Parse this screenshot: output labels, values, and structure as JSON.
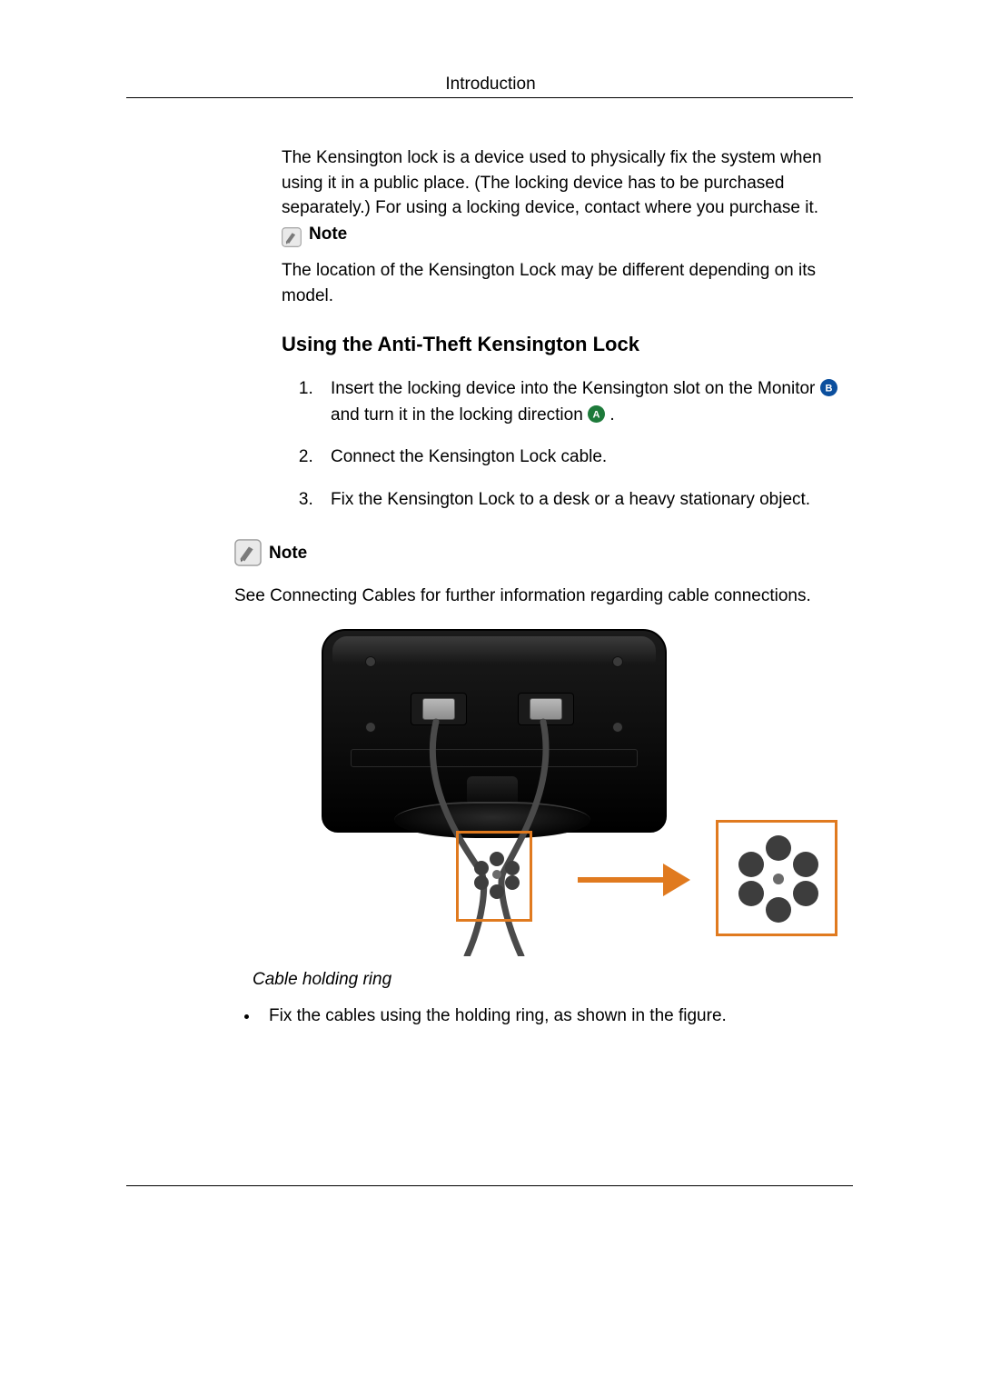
{
  "header": {
    "title": "Introduction"
  },
  "intro": {
    "para": "The Kensington lock is a device used to physically fix the system when using it in a public place. (The locking device has to be purchased separately.) For using a locking device, contact where you purchase it.",
    "note_label": "Note",
    "note_text": "The location of the Kensington Lock may be different depending on its model."
  },
  "section": {
    "heading": "Using the Anti-Theft Kensington Lock",
    "step1_a": "Insert the locking device into the Kensington slot on the Monitor ",
    "step1_b": "and turn it in the locking direction ",
    "step1_c": ".",
    "badge_b": "B",
    "badge_a": "A",
    "step2": "Connect the Kensington Lock cable.",
    "step3": "Fix the Kensington Lock to a desk or a heavy stationary object."
  },
  "note2": {
    "label": "Note",
    "text": "See Connecting Cables for further information regarding cable connections."
  },
  "figure": {
    "caption": "Cable holding ring",
    "bullet": "Fix the cables using the holding ring, as shown in the figure."
  },
  "icons": {
    "note": "note-icon"
  }
}
